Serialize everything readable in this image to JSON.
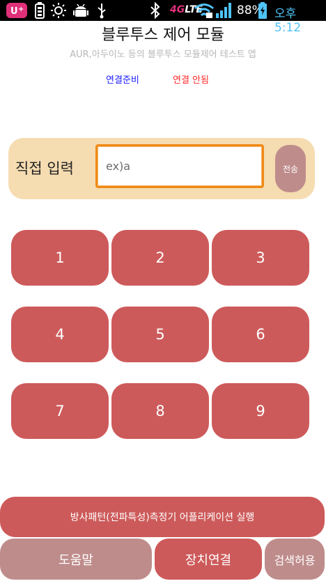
{
  "status_bar": {
    "network_type": "4G",
    "network_suffix": "LTE",
    "battery": "88%",
    "time": "오후 5:12",
    "icons": [
      "u-plus-icon",
      "battery-saver-icon",
      "brightness-icon",
      "android-debug-icon",
      "usb-icon",
      "bluetooth-icon",
      "wifi-icon",
      "signal-icon",
      "battery-icon"
    ]
  },
  "header": {
    "title": "블루투스 제어 모듈",
    "subtitle": "AUR,아두이노 등의 블루투스 모듈제어 테스트 앱"
  },
  "connection": {
    "ready_label": "연결준비",
    "status_label": "연결 안됨",
    "ready_color": "#1a1aff",
    "status_color": "#ff2a2a"
  },
  "direct_input": {
    "label": "직접 입력",
    "placeholder": "ex)a",
    "value": "",
    "send_label": "전송"
  },
  "keypad": {
    "keys": [
      "1",
      "2",
      "3",
      "4",
      "5",
      "6",
      "7",
      "8",
      "9"
    ]
  },
  "bottom": {
    "run_label": "방사패턴(전파특성)측정기 어플리케이션 실행",
    "help_label": "도움말",
    "connect_label": "장치연결",
    "allow_label": "검색허용"
  },
  "colors": {
    "key_red": "#cd5a5a",
    "muted_button": "#bf8c8c",
    "panel_beige": "#f5dcb1",
    "input_border": "#f08a16"
  }
}
